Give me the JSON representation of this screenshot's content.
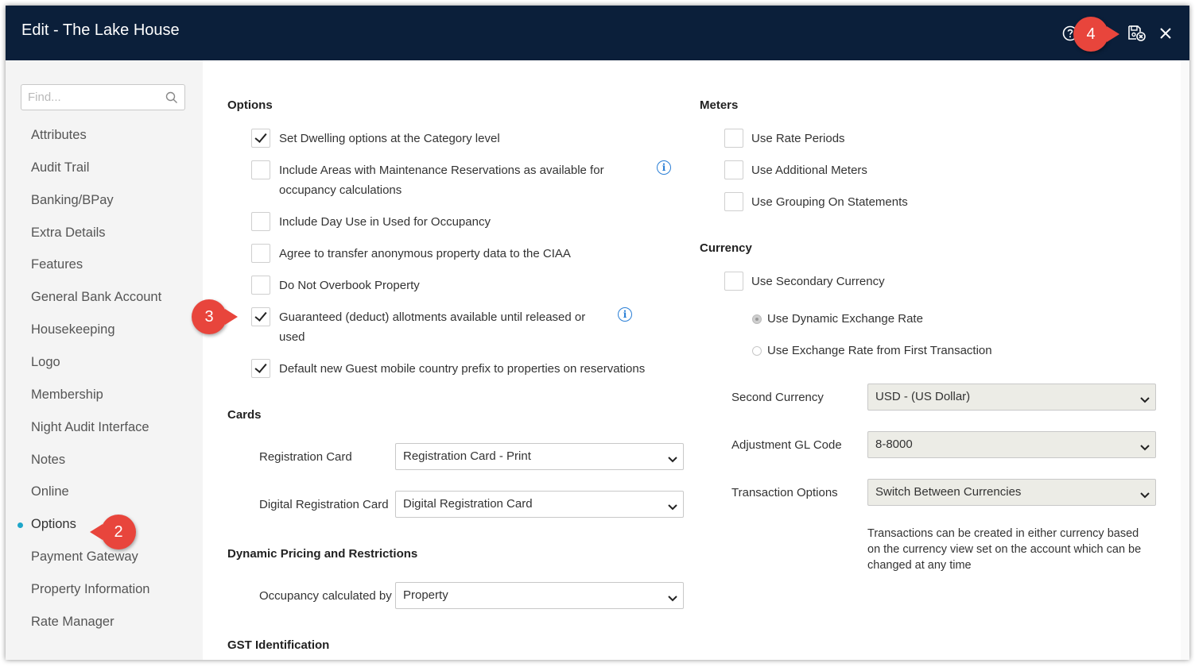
{
  "window": {
    "title": "Edit - The Lake House"
  },
  "toolbar": {
    "help_icon": "help-icon",
    "save_icon": "save-close-icon",
    "close_icon": "close-icon"
  },
  "badges": {
    "b2": "2",
    "b3": "3",
    "b4": "4",
    "color": "#e8453c"
  },
  "sidebar": {
    "search_placeholder": "Find...",
    "items": [
      {
        "label": "Attributes"
      },
      {
        "label": "Audit Trail"
      },
      {
        "label": "Banking/BPay"
      },
      {
        "label": "Extra Details"
      },
      {
        "label": "Features"
      },
      {
        "label": "General Bank Account"
      },
      {
        "label": "Housekeeping"
      },
      {
        "label": "Logo"
      },
      {
        "label": "Membership"
      },
      {
        "label": "Night Audit Interface"
      },
      {
        "label": "Notes"
      },
      {
        "label": "Online"
      },
      {
        "label": "Options"
      },
      {
        "label": "Payment Gateway"
      },
      {
        "label": "Property Information"
      },
      {
        "label": "Rate Manager"
      }
    ],
    "active": "Options",
    "active_color": "#1ea6c9"
  },
  "options": {
    "heading": "Options",
    "items": [
      {
        "label": "Set Dwelling options at the Category level",
        "checked": true
      },
      {
        "label": "Include Areas with Maintenance Reservations as available for",
        "label2": "occupancy calculations",
        "checked": false
      },
      {
        "label": "Include Day Use in Used for Occupancy",
        "checked": false
      },
      {
        "label": "Agree to transfer anonymous property data to the CIAA",
        "checked": false
      },
      {
        "label": "Do Not Overbook Property",
        "checked": false
      },
      {
        "label": "Guaranteed (deduct) allotments available until released or",
        "label2": "used",
        "checked": true
      },
      {
        "label": "Default new Guest mobile country prefix to properties on reservations",
        "checked": true
      }
    ]
  },
  "cards": {
    "heading": "Cards",
    "registration_card_label": "Registration Card",
    "registration_card_value": "Registration Card - Print",
    "digital_card_label": "Digital Registration Card",
    "digital_card_value": "Digital Registration Card"
  },
  "pricing": {
    "heading": "Dynamic Pricing and Restrictions",
    "occupancy_label": "Occupancy calculated by",
    "occupancy_value": "Property"
  },
  "gst": {
    "heading": "GST Identification"
  },
  "meters": {
    "heading": "Meters",
    "items": [
      {
        "label": "Use Rate Periods",
        "checked": false
      },
      {
        "label": "Use Additional Meters",
        "checked": false
      },
      {
        "label": "Use Grouping On Statements",
        "checked": false
      }
    ]
  },
  "currency": {
    "heading": "Currency",
    "secondary_label": "Use Secondary Currency",
    "secondary_checked": false,
    "radio_dynamic": "Use Dynamic Exchange Rate",
    "radio_first": "Use Exchange Rate from First Transaction",
    "second_currency_label": "Second Currency",
    "second_currency_value": "USD - (US Dollar)",
    "gl_label": "Adjustment GL Code",
    "gl_value": "8-8000",
    "txn_label": "Transaction Options",
    "txn_value": "Switch Between Currencies",
    "note_line1": "Transactions can be created in either currency based",
    "note_line2": "on the currency view set on the account which can be",
    "note_line3": "changed at any time"
  }
}
